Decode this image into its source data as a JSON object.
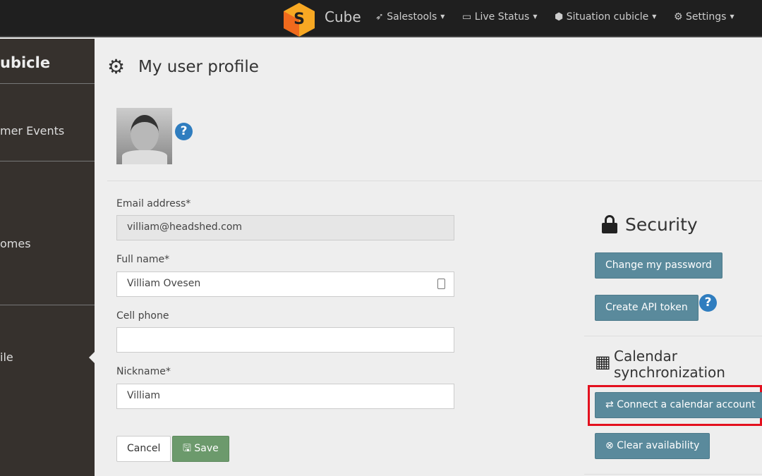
{
  "topbar": {
    "brand": "Cube",
    "nav": [
      {
        "label": "Salestools",
        "icon": "rocket-icon"
      },
      {
        "label": "Live Status",
        "icon": "monitor-icon"
      },
      {
        "label": "Situation cubicle",
        "icon": "cube-icon"
      },
      {
        "label": "Settings",
        "icon": "gear-icon"
      }
    ]
  },
  "sidebar": {
    "title": "ubicle",
    "items": [
      {
        "label": "mer Events"
      },
      {
        "label": "omes"
      },
      {
        "label": "ile",
        "active": true
      }
    ]
  },
  "page": {
    "title": "My user profile",
    "form": {
      "email_label": "Email address*",
      "email_value": "villiam@headshed.com",
      "fullname_label": "Full name*",
      "fullname_value": "Villiam Ovesen",
      "cell_label": "Cell phone",
      "cell_value": "",
      "nickname_label": "Nickname*",
      "nickname_value": "Villiam",
      "cancel": "Cancel",
      "save": "Save"
    },
    "security": {
      "title": "Security",
      "change_password": "Change my password",
      "create_token": "Create API token"
    },
    "calendar": {
      "title": "Calendar synchronization",
      "connect": "Connect a calendar account",
      "clear": "Clear availability"
    }
  },
  "colors": {
    "button": "#5a8a9c",
    "save": "#6c9a6c",
    "highlight": "#e3101e",
    "help": "#2f7dbf"
  }
}
